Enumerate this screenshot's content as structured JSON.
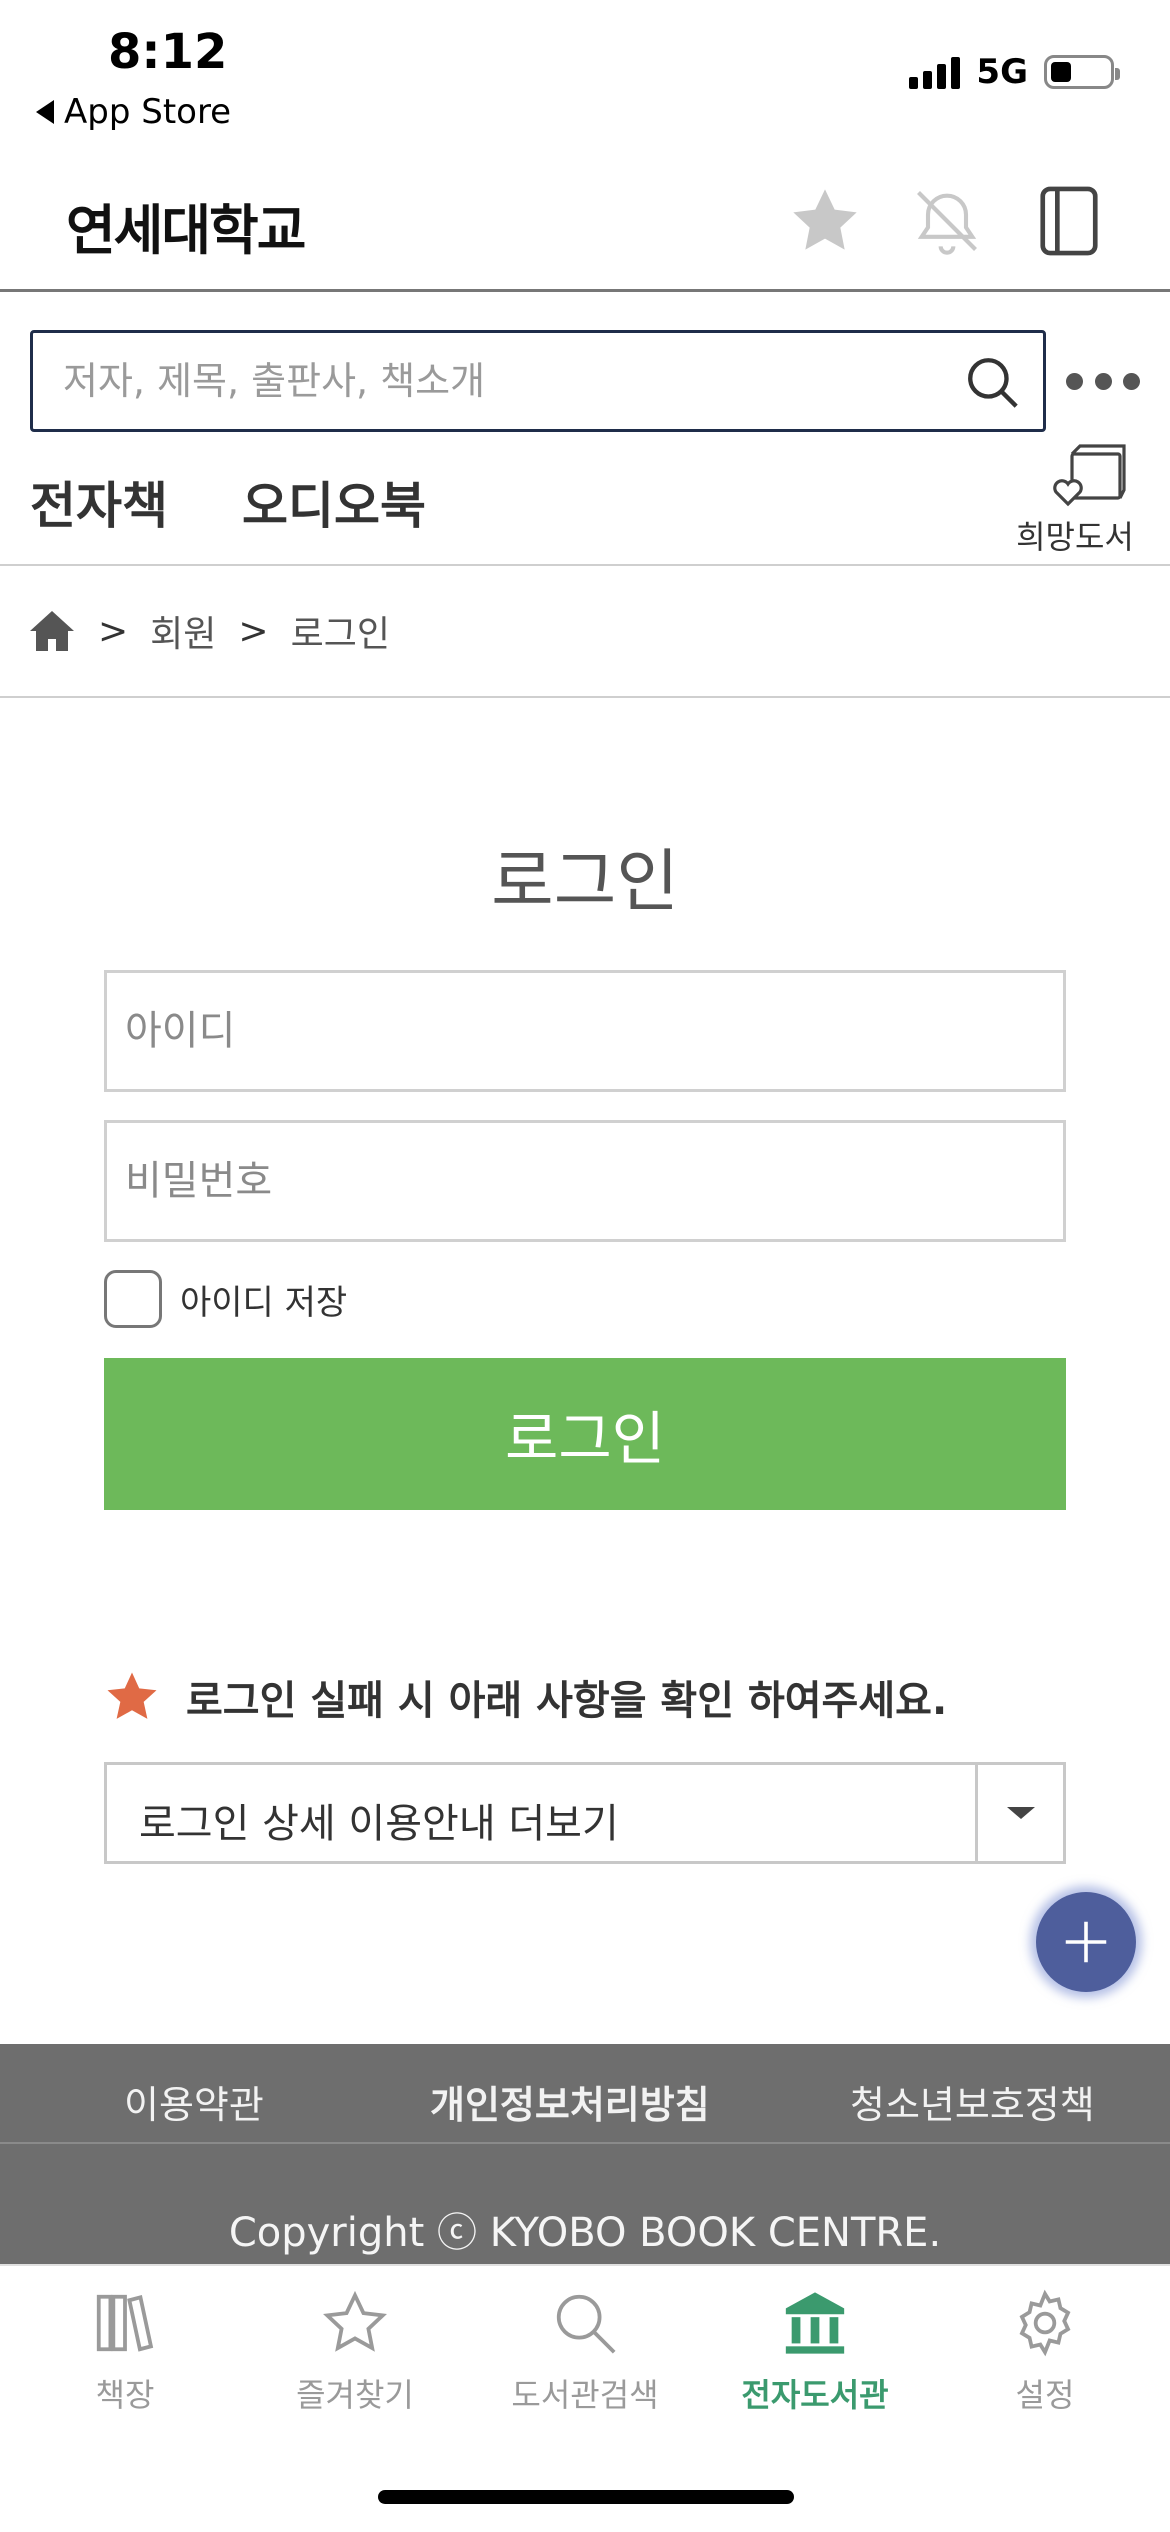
{
  "status_bar": {
    "time": "8:12",
    "back_label": "App Store",
    "network": "5G",
    "battery_level": 0.35
  },
  "header": {
    "brand": "연세대학교",
    "icons": [
      "star-icon",
      "bell-off-icon",
      "book-icon"
    ]
  },
  "search": {
    "placeholder": "저자, 제목, 출판사, 책소개",
    "value": ""
  },
  "tabs": {
    "ebook": "전자책",
    "audiobook": "오디오북",
    "wish_label": "희망도서"
  },
  "breadcrumb": {
    "sep": ">",
    "items": [
      "회원",
      "로그인"
    ]
  },
  "login": {
    "title": "로그인",
    "id_placeholder": "아이디",
    "pw_placeholder": "비밀번호",
    "remember_label": "아이디 저장",
    "remember_checked": false,
    "button_label": "로그인"
  },
  "notice": {
    "text": "로그인 실패 시 아래 사항을 확인 하여주세요.",
    "star_color": "#e06a45"
  },
  "guide_select": {
    "selected": "로그인 상세 이용안내 더보기"
  },
  "footer": {
    "links": [
      "이용약관",
      "개인정보처리방침",
      "청소년보호정책"
    ],
    "copyright": "Copyright ⓒ KYOBO BOOK CENTRE."
  },
  "bottom_nav": {
    "items": [
      {
        "label": "책장",
        "icon": "bookshelf-icon"
      },
      {
        "label": "즐겨찾기",
        "icon": "star-outline-icon"
      },
      {
        "label": "도서관검색",
        "icon": "search-icon"
      },
      {
        "label": "전자도서관",
        "icon": "library-icon"
      },
      {
        "label": "설정",
        "icon": "gear-icon"
      }
    ],
    "active_index": 3
  },
  "colors": {
    "accent_green": "#6db95a",
    "nav_active": "#3b9a6e",
    "fab": "#4e5e9c",
    "footer_bg": "#6e6e6e"
  }
}
